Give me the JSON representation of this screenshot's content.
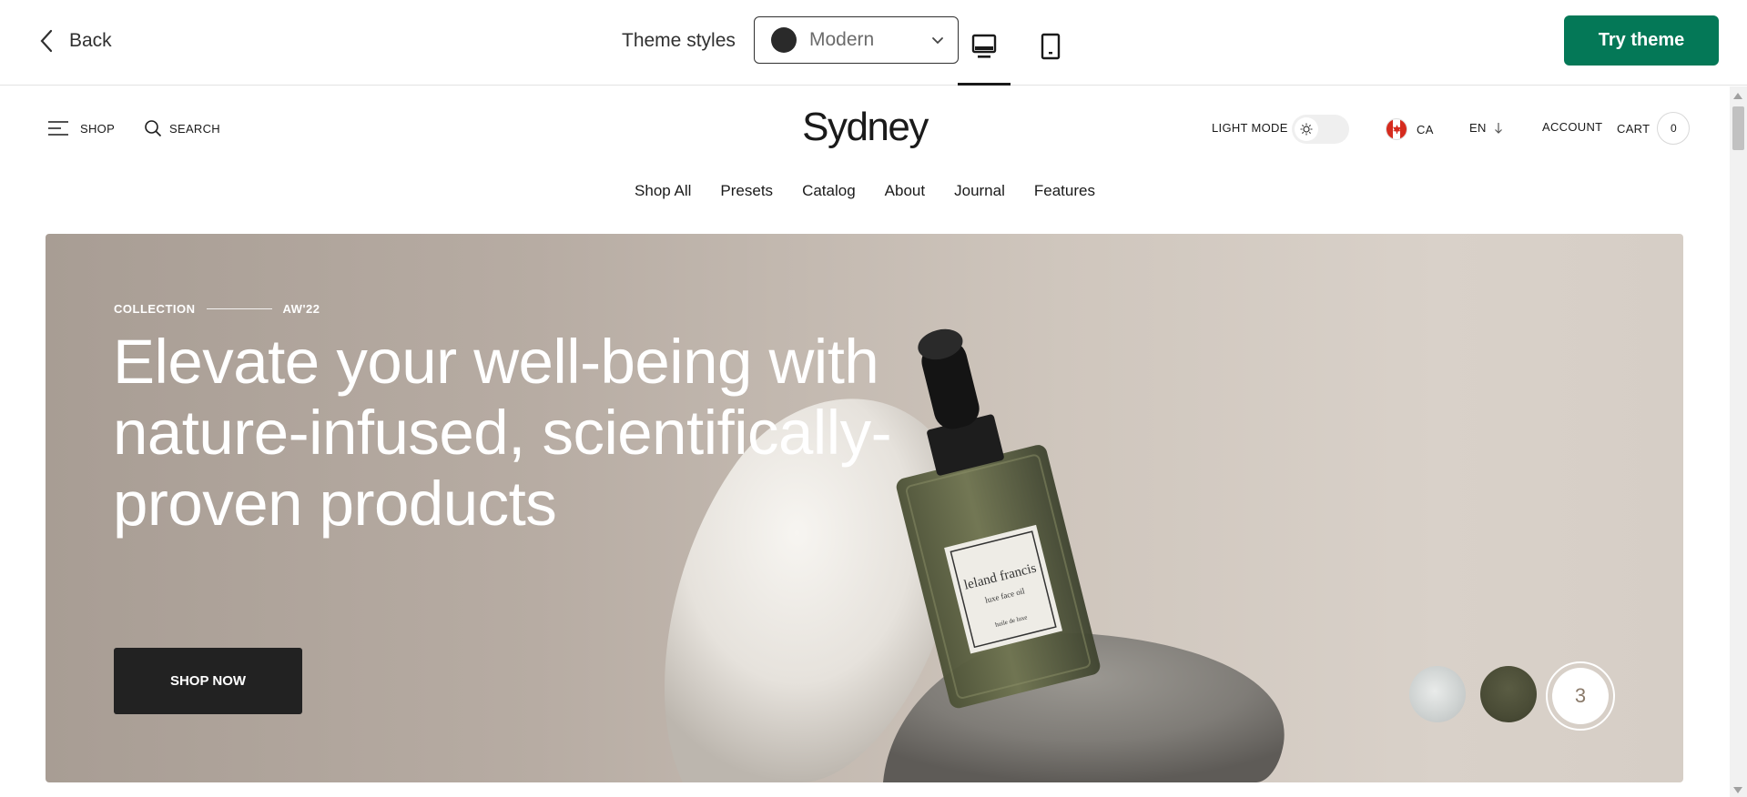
{
  "editor": {
    "back_label": "Back",
    "theme_styles_label": "Theme styles",
    "theme_select_value": "Modern",
    "try_theme_label": "Try theme",
    "accent_color": "#047857"
  },
  "store": {
    "shop_label": "SHOP",
    "search_label": "SEARCH",
    "logo": "Sydney",
    "light_mode_label": "LIGHT MODE",
    "country_code": "CA",
    "language": "EN",
    "account_label": "ACCOUNT",
    "cart_label": "CART",
    "cart_count": "0",
    "nav": [
      "Shop All",
      "Presets",
      "Catalog",
      "About",
      "Journal",
      "Features"
    ]
  },
  "hero": {
    "kicker_left": "COLLECTION",
    "kicker_right": "AW'22",
    "title": "Elevate your well-being with nature-infused, scientifically-proven products",
    "cta_label": "SHOP NOW",
    "product_label_brand": "leland francis",
    "product_label_name": "luxe face oil",
    "product_label_sub": "huile de luxe",
    "slide_indicator": "3"
  },
  "icons": {
    "back": "chevron-left-icon",
    "select": "chevron-down-icon",
    "desktop": "desktop-icon",
    "mobile": "mobile-icon",
    "menu": "hamburger-icon",
    "search": "search-icon",
    "theme": "sun-icon",
    "lang": "arrow-down-icon"
  }
}
